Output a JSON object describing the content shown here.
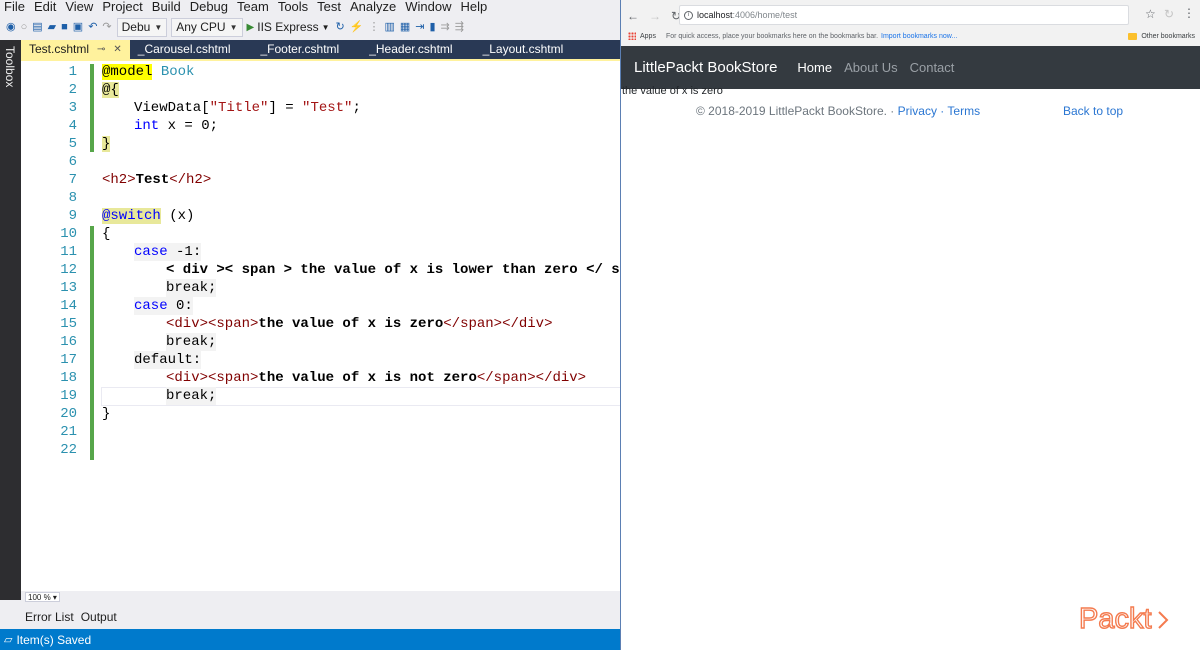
{
  "vs": {
    "menu": [
      "File",
      "Edit",
      "View",
      "Project",
      "Build",
      "Debug",
      "Team",
      "Tools",
      "Test",
      "Analyze",
      "Window",
      "Help"
    ],
    "toolbar": {
      "config": "Debu",
      "platform": "Any CPU",
      "run_target": "IIS Express"
    },
    "toolbox_label": "Toolbox",
    "tabs": [
      "Test.cshtml",
      "_Carousel.cshtml",
      "_Footer.cshtml",
      "_Header.cshtml",
      "_Layout.cshtml"
    ],
    "line_numbers": [
      "1",
      "2",
      "3",
      "4",
      "5",
      "6",
      "7",
      "8",
      "9",
      "10",
      "11",
      "12",
      "13",
      "14",
      "15",
      "16",
      "17",
      "18",
      "19",
      "20",
      "21",
      "22"
    ],
    "code": {
      "l1_a": "@model",
      "l1_b": "Book",
      "l2": "@{",
      "l3_a": "ViewData[",
      "l3_b": "\"Title\"",
      "l3_c": "] = ",
      "l3_d": "\"Test\"",
      "l3_e": ";",
      "l4_a": "int",
      "l4_b": " x = 0;",
      "l5": "}",
      "l7_a": "<h2>",
      "l7_b": "Test",
      "l7_c": "</h2>",
      "l9_a": "@switch",
      "l9_b": " (x)",
      "l10": "{",
      "l11_a": "case",
      "l11_b": " -1:",
      "l12": "< div >< span > the value of x is lower than zero </ spa",
      "l13": "break;",
      "l14_a": "case",
      "l14_b": " 0:",
      "l15_a": "<div><span>",
      "l15_b": "the value of x is zero",
      "l15_c": "</span></div>",
      "l16": "break;",
      "l17": "default:",
      "l18_a": "<div><span>",
      "l18_b": "the value of x is not zero",
      "l18_c": "</span></div>",
      "l19": "break;",
      "l20": "}"
    },
    "zoom": "100 %",
    "bottom_tabs": [
      "Error List",
      "Output"
    ],
    "status": "Item(s) Saved"
  },
  "browser": {
    "url_host": "localhost",
    "url_path": ":4006/home/test",
    "bookmarks": {
      "apps": "Apps",
      "hint": "For quick access, place your bookmarks here on the bookmarks bar.",
      "import": "Import bookmarks now...",
      "other": "Other bookmarks"
    },
    "site": {
      "brand": "LittlePackt BookStore",
      "nav": [
        "Home",
        "About Us",
        "Contact"
      ],
      "output": "the value of x is zero",
      "footer_text": "© 2018-2019 LittlePackt BookStore. · ",
      "footer_privacy": "Privacy",
      "footer_sep": " · ",
      "footer_terms": "Terms",
      "back_to_top": "Back to top"
    }
  },
  "logo": {
    "text": "Packt",
    "color": "#f47b4f"
  }
}
